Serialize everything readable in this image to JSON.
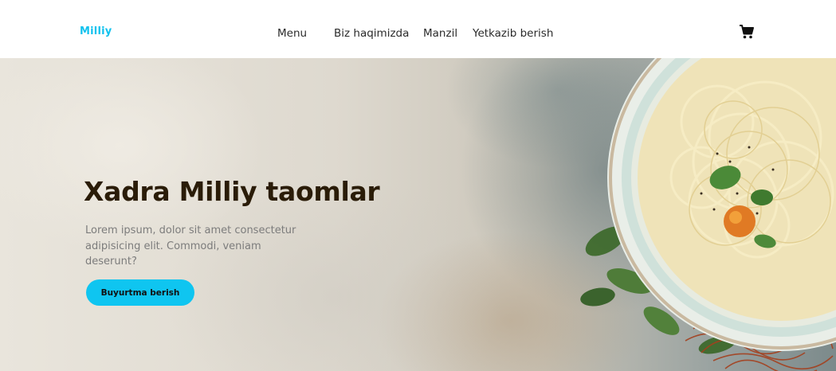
{
  "header": {
    "logo": "Milliy",
    "nav": [
      {
        "label": "Menu"
      },
      {
        "label": "Biz haqimizda"
      },
      {
        "label": "Manzil"
      },
      {
        "label": "Yetkazib berish"
      }
    ],
    "cart_icon": "shopping-cart-icon"
  },
  "hero": {
    "title": "Xadra Milliy taomlar",
    "text": "Lorem ipsum, dolor sit amet consectetur adipisicing elit. Commodi, veniam deserunt?",
    "button_label": "Buyurtma berish",
    "image": "noodle-soup-bowl-image"
  },
  "colors": {
    "accent": "#0fc5f0",
    "title": "#2a1c08",
    "text": "#7c7c7c"
  }
}
